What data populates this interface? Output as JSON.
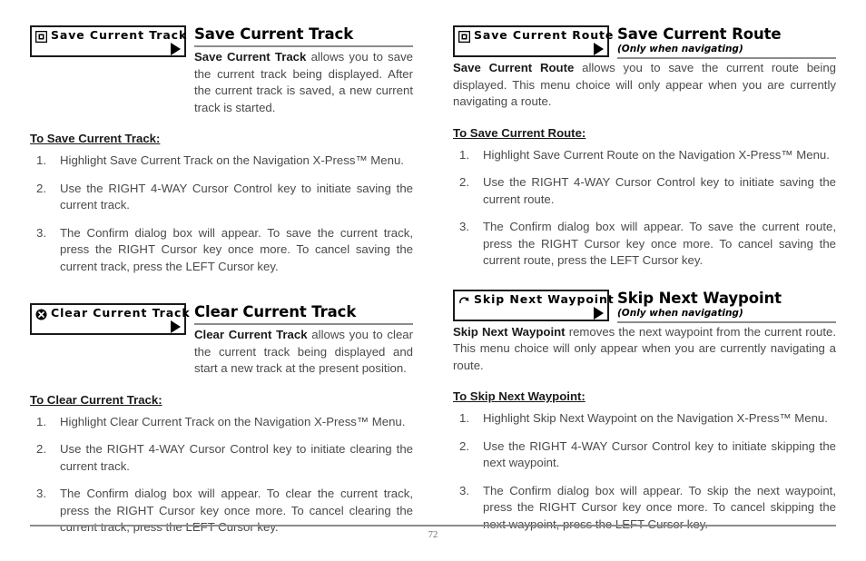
{
  "page": {
    "number": "72"
  },
  "left_column": {
    "sections": [
      {
        "chip": {
          "label": "Save Current Track",
          "icon": "save-disk-icon",
          "arrow": "right-triangle-icon"
        },
        "title": "Save Current Track",
        "subtitle": "",
        "intro_bold": "Save Current Track",
        "intro_rest": " allows you to save the current track being displayed. After the current track is saved, a new current track is started.",
        "steps_heading": "To Save Current Track:",
        "steps": [
          "Highlight Save Current Track on the Navigation X-Press™ Menu.",
          "Use the RIGHT 4-WAY Cursor Control key to initiate saving the current track.",
          "The Confirm dialog box will appear. To save the current track, press the RIGHT Cursor key once more. To cancel saving the current track, press the LEFT Cursor key."
        ]
      },
      {
        "chip": {
          "label": "Clear Current Track",
          "icon": "clear-x-circle-icon",
          "arrow": "right-triangle-icon"
        },
        "title": "Clear Current Track",
        "subtitle": "",
        "intro_bold": "Clear Current Track",
        "intro_rest": " allows you to clear the current track being displayed and start a new track at the present position.",
        "steps_heading": "To Clear Current Track:",
        "steps": [
          "Highlight Clear Current Track on the Navigation X-Press™ Menu.",
          "Use the RIGHT 4-WAY Cursor Control key to initiate clearing the current track.",
          "The Confirm dialog box will appear. To clear the current track, press the RIGHT Cursor key once more. To cancel clearing the current track, press the LEFT Cursor key."
        ]
      }
    ]
  },
  "right_column": {
    "sections": [
      {
        "chip": {
          "label": "Save Current Route",
          "icon": "save-disk-icon",
          "arrow": "right-triangle-icon"
        },
        "title": "Save Current Route",
        "subtitle": "(Only when navigating)",
        "intro_bold": "Save Current Route",
        "intro_rest": " allows you to save the current route being displayed. This menu choice will only appear when you are currently navigating a route.",
        "steps_heading": "To Save Current Route:",
        "steps": [
          "Highlight Save Current Route on the Navigation X-Press™ Menu.",
          "Use the RIGHT 4-WAY Cursor Control key to initiate saving the current route.",
          "The Confirm dialog box will appear. To save the current route, press the RIGHT Cursor key once more. To cancel saving the current route, press the LEFT Cursor key."
        ]
      },
      {
        "chip": {
          "label": "Skip Next Waypoint",
          "icon": "skip-curved-arrow-icon",
          "arrow": "right-triangle-icon"
        },
        "title": "Skip Next Waypoint",
        "subtitle": "(Only when navigating)",
        "intro_bold": "Skip Next Waypoint",
        "intro_rest": " removes the next waypoint from the current route. This menu choice will only appear when you are currently navigating a route.",
        "steps_heading": "To Skip Next Waypoint:",
        "steps": [
          "Highlight Skip Next Waypoint on the Navigation X-Press™ Menu.",
          "Use the RIGHT 4-WAY Cursor Control key to initiate skipping the next waypoint.",
          "The Confirm dialog box will appear. To skip the next waypoint, press the RIGHT Cursor key once more. To cancel skipping the next waypoint, press the LEFT Cursor key."
        ]
      }
    ]
  }
}
